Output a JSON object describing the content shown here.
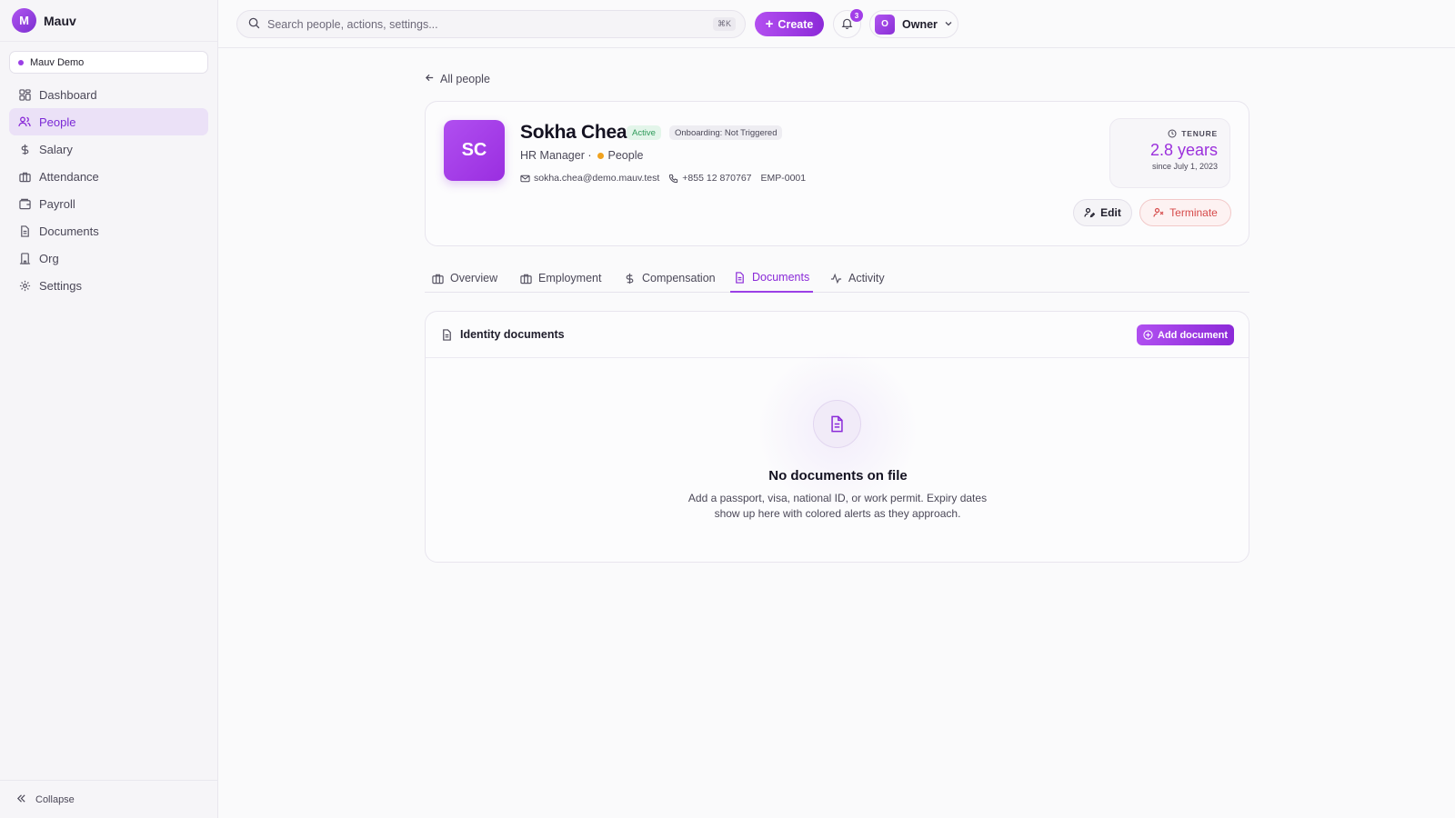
{
  "brand": {
    "logo_letter": "M",
    "name": "Mauv"
  },
  "workspace": {
    "name": "Mauv Demo"
  },
  "sidebar": {
    "items": [
      {
        "label": "Dashboard",
        "icon": "grid-icon"
      },
      {
        "label": "People",
        "icon": "users-icon",
        "active": true
      },
      {
        "label": "Salary",
        "icon": "dollar-icon"
      },
      {
        "label": "Attendance",
        "icon": "briefcase-icon"
      },
      {
        "label": "Payroll",
        "icon": "wallet-icon"
      },
      {
        "label": "Documents",
        "icon": "file-icon"
      },
      {
        "label": "Org",
        "icon": "building-icon"
      },
      {
        "label": "Settings",
        "icon": "gear-icon"
      }
    ],
    "collapse_label": "Collapse"
  },
  "topbar": {
    "search_placeholder": "Search people, actions, settings...",
    "search_shortcut": "⌘K",
    "create_label": "Create",
    "notification_count": "3",
    "user_initial": "O",
    "user_role": "Owner"
  },
  "back_link": "All people",
  "profile": {
    "initials": "SC",
    "name": "Sokha Chea",
    "status": "Active",
    "onboarding": "Onboarding: Not Triggered",
    "role": "HR Manager ·",
    "department": "People",
    "email": "sokha.chea@demo.mauv.test",
    "phone": "+855 12 870767",
    "employee_id": "EMP-0001",
    "tenure_label": "TENURE",
    "tenure_value": "2.8 years",
    "tenure_since": "since July 1, 2023",
    "edit_label": "Edit",
    "terminate_label": "Terminate"
  },
  "tabs": [
    {
      "label": "Overview"
    },
    {
      "label": "Employment"
    },
    {
      "label": "Compensation"
    },
    {
      "label": "Documents",
      "active": true
    },
    {
      "label": "Activity"
    }
  ],
  "documents": {
    "section_title": "Identity documents",
    "add_label": "Add document",
    "empty_title": "No documents on file",
    "empty_text": "Add a passport, visa, national ID, or work permit. Expiry dates show up here with colored alerts as they approach."
  },
  "colors": {
    "accent": "#9b3fe6",
    "active_badge": "#2e9a5a",
    "danger": "#d64a4a",
    "department_dot": "#f0a21f"
  }
}
